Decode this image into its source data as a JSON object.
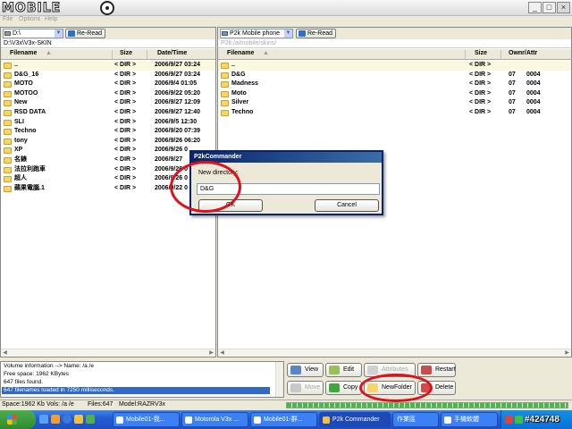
{
  "app": {
    "logo_text": "MOBILE",
    "menu": [
      "File",
      "Options",
      "Help"
    ]
  },
  "left_pane": {
    "drive": "D:\\",
    "reread": "Re-Read",
    "path": "D:\\V3x\\V3x-SKIN",
    "columns": {
      "filename": "Filename",
      "size": "Size",
      "date": "Date/Time"
    },
    "rows": [
      {
        "name": "..",
        "size": "< DIR >",
        "date": "2006/9/27 03:24"
      },
      {
        "name": "D&G_16",
        "size": "< DIR >",
        "date": "2006/9/27 03:24"
      },
      {
        "name": "MOTO",
        "size": "< DIR >",
        "date": "2006/9/4 01:05"
      },
      {
        "name": "MOTOO",
        "size": "< DIR >",
        "date": "2006/9/22 05:20"
      },
      {
        "name": "New",
        "size": "< DIR >",
        "date": "2006/9/27 12:09"
      },
      {
        "name": "RSD DATA",
        "size": "< DIR >",
        "date": "2006/9/27 12:40"
      },
      {
        "name": "SLI",
        "size": "< DIR >",
        "date": "2006/9/5 12:30"
      },
      {
        "name": "Techno",
        "size": "< DIR >",
        "date": "2006/9/20 07:39"
      },
      {
        "name": "tony",
        "size": "< DIR >",
        "date": "2006/9/26 06:20"
      },
      {
        "name": "XP",
        "size": "< DIR >",
        "date": "2006/9/26 0"
      },
      {
        "name": "名錶",
        "size": "< DIR >",
        "date": "2006/9/27"
      },
      {
        "name": "法拉利跑車",
        "size": "< DIR >",
        "date": "2006/9/26 0"
      },
      {
        "name": "超人",
        "size": "< DIR >",
        "date": "2006/9/26 0"
      },
      {
        "name": "蘋果電腦.1",
        "size": "< DIR >",
        "date": "2006/9/22 0"
      }
    ]
  },
  "right_pane": {
    "device": "P2k Mobile phone",
    "reread": "Re-Read",
    "path": "P2k:/a/mobile/skins/",
    "columns": {
      "filename": "Filename",
      "size": "Size",
      "owner": "Ownr/Attr"
    },
    "rows": [
      {
        "name": "..",
        "size": "< DIR >",
        "owner": "",
        "attr": ""
      },
      {
        "name": "D&G",
        "size": "< DIR >",
        "owner": "07",
        "attr": "0004"
      },
      {
        "name": "Madness",
        "size": "< DIR >",
        "owner": "07",
        "attr": "0004"
      },
      {
        "name": "Moto",
        "size": "< DIR >",
        "owner": "07",
        "attr": "0004"
      },
      {
        "name": "Silver",
        "size": "< DIR >",
        "owner": "07",
        "attr": "0004"
      },
      {
        "name": "Techno",
        "size": "< DIR >",
        "owner": "07",
        "attr": "0004"
      }
    ]
  },
  "info": {
    "lines": [
      "Volume information --> Name: /a /e",
      "Free space: 1962 KBytes",
      "647 files found.",
      "647 filenames loaded in 7250 milliseconds."
    ]
  },
  "buttons": {
    "view": "View",
    "edit": "Edit",
    "attributes": "Attributes",
    "restart": "Restart",
    "move": "Move",
    "copy": "Copy",
    "new_folder": "NewFolder",
    "delete": "Delete"
  },
  "status": {
    "space": "Space:1962 Kb",
    "vols": "Vols: /a /e",
    "files": "Files:647",
    "model": "Model:RAZRV3x",
    "progress_fraction": 1.0
  },
  "taskbar": {
    "tasks": [
      "Mobile01-我...",
      "Motorola V3x ...",
      "Mobile01-群...",
      "P2k Commander"
    ],
    "tray_labels": [
      "作業區",
      "手機軟體"
    ],
    "watermark": "#424748"
  },
  "dialog": {
    "title": "P2kCommander",
    "label": "New directory:",
    "value": "D&G",
    "ok": "OK",
    "cancel": "Cancel"
  }
}
